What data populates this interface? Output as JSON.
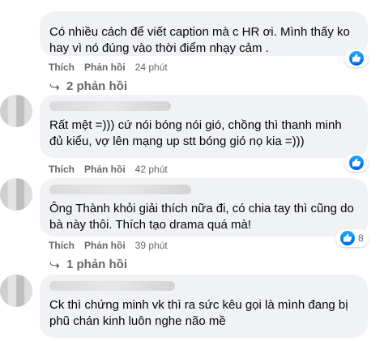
{
  "comments": [
    {
      "text": "Có nhiều cách để viết caption mà c HR ơi. Mình thấy ko hay vì nó đúng vào thời điểm nhạy cảm .",
      "like_label": "Thích",
      "reply_label": "Phản hồi",
      "time": "24 phút",
      "reaction_icon": "like-icon",
      "replies_label": "2 phản hồi"
    },
    {
      "text": "Rất mệt =))) cứ nói bóng nói gió, chồng thì thanh minh đủ kiểu, vợ lên mạng up stt bóng gió nọ kia =)))",
      "like_label": "Thích",
      "reply_label": "Phản hồi",
      "time": "42 phút",
      "reaction_icon": "like-icon"
    },
    {
      "text": "Ông Thành khỏi giải thích nữa đi, có chia tay thì cũng do bà này thôi. Thích tạo drama quá mà!",
      "like_label": "Thích",
      "reply_label": "Phản hồi",
      "time": "39 phút",
      "reaction_icon": "like-icon",
      "reaction_count": "8",
      "replies_label": "1 phản hồi"
    },
    {
      "text": "Ck thì chứng minh vk thì ra sức kêu gọi là mình đang bị phũ chán kinh luôn nghe não mề"
    }
  ],
  "colors": {
    "bubble_bg": "#f0f2f5",
    "secondary_text": "#65676b",
    "like_blue": "#0062df"
  }
}
